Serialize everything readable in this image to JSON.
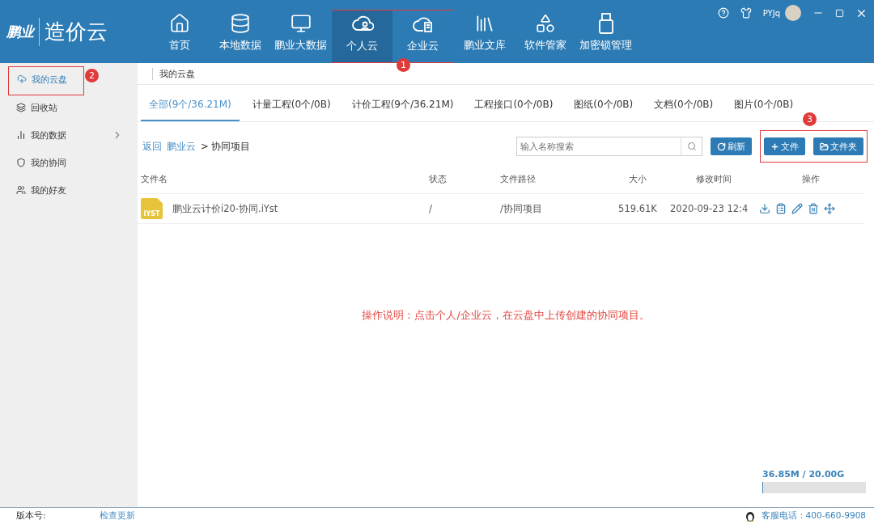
{
  "app": {
    "brand": "鹏业",
    "product": "造价云"
  },
  "nav": [
    {
      "label": "首页",
      "selected": false,
      "framed": false
    },
    {
      "label": "本地数据",
      "selected": false,
      "framed": false
    },
    {
      "label": "鹏业大数据",
      "selected": false,
      "framed": false
    },
    {
      "label": "个人云",
      "selected": true,
      "framed": true
    },
    {
      "label": "企业云",
      "selected": false,
      "framed": true
    },
    {
      "label": "鹏业文库",
      "selected": false,
      "framed": false
    },
    {
      "label": "软件管家",
      "selected": false,
      "framed": false
    },
    {
      "label": "加密锁管理",
      "selected": false,
      "framed": false
    }
  ],
  "nav_callout": "1",
  "user": {
    "name": "PYJq"
  },
  "sidebar": {
    "callout": "2",
    "items": [
      {
        "label": "我的云盘",
        "selected": true,
        "framed": true,
        "has_submenu": false
      },
      {
        "label": "回收站",
        "selected": false,
        "framed": false,
        "has_submenu": false
      },
      {
        "label": "我的数据",
        "selected": false,
        "framed": false,
        "has_submenu": true
      },
      {
        "label": "我的协同",
        "selected": false,
        "framed": false,
        "has_submenu": false
      },
      {
        "label": "我的好友",
        "selected": false,
        "framed": false,
        "has_submenu": false
      }
    ]
  },
  "breadcrumb": "我的云盘",
  "tabs": [
    {
      "label": "全部(9个/36.21M)",
      "selected": true
    },
    {
      "label": "计量工程(0个/0B)",
      "selected": false
    },
    {
      "label": "计价工程(9个/36.21M)",
      "selected": false
    },
    {
      "label": "工程接口(0个/0B)",
      "selected": false
    },
    {
      "label": "图纸(0个/0B)",
      "selected": false
    },
    {
      "label": "文档(0个/0B)",
      "selected": false
    },
    {
      "label": "图片(0个/0B)",
      "selected": false
    }
  ],
  "path": {
    "back": "返回",
    "root": "鹏业云",
    "current": "> 协同项目"
  },
  "search": {
    "placeholder": "输入名称搜索"
  },
  "toolbar": {
    "buttons": [
      {
        "label": "刷新"
      }
    ],
    "highlight": {
      "callout": "3",
      "buttons": [
        {
          "label": "文件"
        },
        {
          "label": "文件夹"
        }
      ]
    }
  },
  "table": {
    "columns": [
      "文件名",
      "状态",
      "文件路径",
      "大小",
      "修改时间",
      "操作"
    ],
    "rows": [
      {
        "badge": "IYST",
        "name": "鹏业云计价i20-协同.iYst",
        "status": "/",
        "path": "/协同项目",
        "size": "519.61K",
        "modified": "2020-09-23 12:4"
      }
    ]
  },
  "note": "操作说明：点击个人/企业云，在云盘中上传创建的协同项目。",
  "quota": {
    "reading": "36.85M / 20.00G",
    "level": 0.002
  },
  "status_bar": {
    "version_label": "版本号:",
    "update": "检查更新",
    "hotline": "客服电话：400-660-9908"
  }
}
